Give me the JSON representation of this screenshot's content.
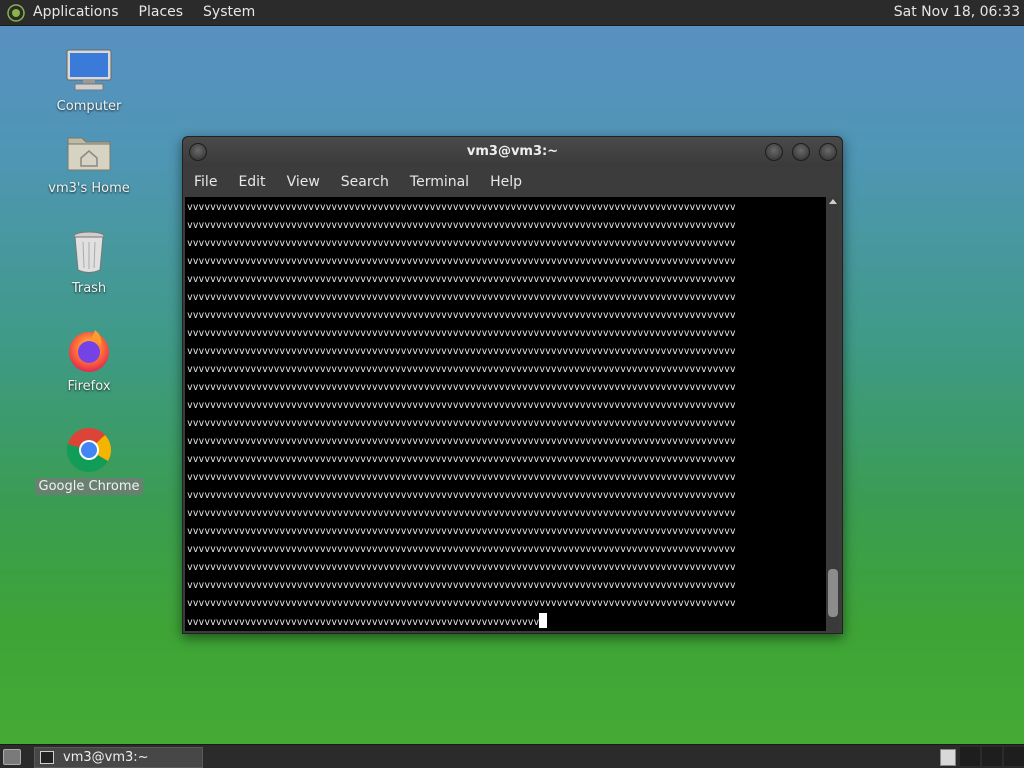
{
  "top_panel": {
    "menus": [
      "Applications",
      "Places",
      "System"
    ],
    "clock": "Sat Nov 18, 06:33"
  },
  "desktop_icons": [
    {
      "label": "Computer",
      "icon": "computer-icon"
    },
    {
      "label": "vm3's Home",
      "icon": "home-folder-icon"
    },
    {
      "label": "Trash",
      "icon": "trash-icon"
    },
    {
      "label": "Firefox",
      "icon": "firefox-icon"
    },
    {
      "label": "Google Chrome",
      "icon": "chrome-icon",
      "selected": true
    }
  ],
  "terminal": {
    "title": "vm3@vm3:~",
    "menu": [
      "File",
      "Edit",
      "View",
      "Search",
      "Terminal",
      "Help"
    ],
    "full_line": "vvvvvvvvvvvvvvvvvvvvvvvvvvvvvvvvvvvvvvvvvvvvvvvvvvvvvvvvvvvvvvvvvvvvvvvvvvvvvvvvvvvvvvvvvvvvvvv",
    "full_line_count": 23,
    "last_line": "vvvvvvvvvvvvvvvvvvvvvvvvvvvvvvvvvvvvvvvvvvvvvvvvvvvvvvvvvvvvv"
  },
  "taskbar": {
    "window_button_label": "vm3@vm3:~"
  },
  "colors": {
    "panel": "#2b2b2b",
    "terminal_bg": "#000000",
    "terminal_fg": "#e8e8e8"
  }
}
